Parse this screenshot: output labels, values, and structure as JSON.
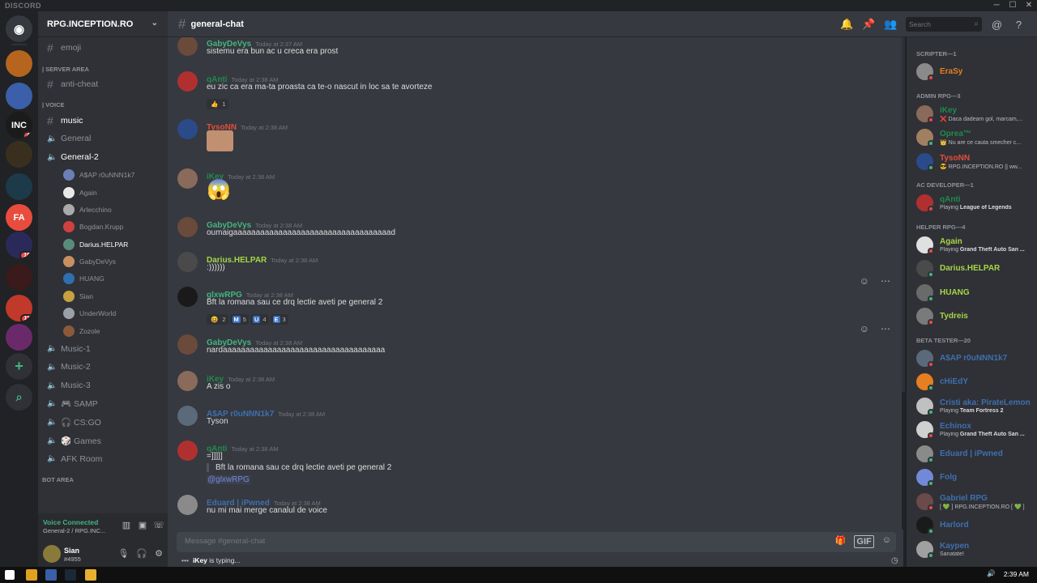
{
  "app": {
    "title": "DISCORD",
    "window_controls": [
      "─",
      "☐",
      "✕"
    ]
  },
  "server": {
    "name": "RPG.INCEPTION.RO"
  },
  "guilds": [
    {
      "name": "home",
      "color": "#36393f",
      "icon": "discord-icon"
    },
    {
      "name": "g1",
      "color": "#b5651d"
    },
    {
      "name": "g2",
      "color": "#3b5fa8"
    },
    {
      "name": "g3",
      "color": "#1b1b1b",
      "label": "INC",
      "badge": "4"
    },
    {
      "name": "g4",
      "color": "#3a2f1e"
    },
    {
      "name": "g5",
      "color": "#1c3a4a"
    },
    {
      "name": "g6",
      "color": "#e84c3d",
      "label": "FA"
    },
    {
      "name": "g7",
      "color": "#2a2a5a",
      "badge": "10"
    },
    {
      "name": "g8",
      "color": "#3a1a1a"
    },
    {
      "name": "g9",
      "color": "#c0392b",
      "badge": "11"
    },
    {
      "name": "g10",
      "color": "#6a2a6a"
    }
  ],
  "channels": {
    "top": [
      {
        "name": "emoji"
      }
    ],
    "server_area": {
      "label": "| SERVER AREA",
      "items": [
        {
          "name": "anti-cheat"
        }
      ]
    },
    "voice": {
      "label": "| VOICE",
      "items": [
        {
          "name": "music",
          "type": "text",
          "active": true
        },
        {
          "name": "General",
          "type": "voice"
        },
        {
          "name": "General-2",
          "type": "voice",
          "active": true,
          "users": [
            {
              "name": "A$AP r0uNNN1k7"
            },
            {
              "name": "Again"
            },
            {
              "name": "Arlecchino"
            },
            {
              "name": "Bogdan.Krupp"
            },
            {
              "name": "Darius.HELPAR",
              "bright": true
            },
            {
              "name": "GabyDeVys"
            },
            {
              "name": "HUANG"
            },
            {
              "name": "Sian"
            },
            {
              "name": "UnderWorld"
            },
            {
              "name": "Zozole"
            }
          ]
        },
        {
          "name": "Music-1",
          "type": "voice"
        },
        {
          "name": "Music-2",
          "type": "voice"
        },
        {
          "name": "Music-3",
          "type": "voice"
        },
        {
          "name": "🎮 SAMP",
          "type": "voice"
        },
        {
          "name": "🎧 CS:GO",
          "type": "voice"
        },
        {
          "name": "🎲 Games",
          "type": "voice"
        },
        {
          "name": "AFK Room",
          "type": "voice"
        }
      ]
    },
    "bot_area": {
      "label": "BOT AREA"
    }
  },
  "voice_panel": {
    "status": "Voice Connected",
    "channel": "General-2 / RPG.INC..."
  },
  "user_panel": {
    "username": "Sian",
    "tag": "#4955"
  },
  "chat": {
    "channel": "general-chat",
    "search_placeholder": "Search",
    "composer_placeholder": "Message #general-chat",
    "typing_user": "iKey",
    "typing_suffix": " is typing..."
  },
  "messages": [
    {
      "user": "GabyDeVys",
      "color": "#43b581",
      "time": "Today at 2:37 AM",
      "text": "sistemu era bun ac u creca era prost",
      "av": "#6a4a3a"
    },
    {
      "user": "qAnti",
      "color": "#1f8b4c",
      "time": "Today at 2:38 AM",
      "text": "eu zic ca era ma-ta proasta ca te-o nascut in loc sa te avorteze",
      "reactions": [
        {
          "e": "👍",
          "n": "1"
        }
      ],
      "av": "#b03030"
    },
    {
      "user": "TysoNN",
      "color": "#e74c3c",
      "time": "Today at 2:38 AM",
      "text": "",
      "image": true,
      "av": "#2a4a8a"
    },
    {
      "user": "iKey",
      "color": "#1f8b4c",
      "time": "Today at 2:38 AM",
      "text": "😱",
      "big_emoji": true,
      "av": "#8a6a5a"
    },
    {
      "user": "GabyDeVys",
      "color": "#43b581",
      "time": "Today at 2:38 AM",
      "text": "oumaigaaaaaaaaaaaaaaaaaaaaaaaaaaaaaaaaaaad",
      "av": "#6a4a3a"
    },
    {
      "user": "Darius.HELPAR",
      "color": "#a5d648",
      "time": "Today at 2:38 AM",
      "text": ":))))))",
      "av": "#4a4a4a"
    },
    {
      "user": "glxwRPG",
      "color": "#43b581",
      "time": "Today at 2:38 AM",
      "text": "Bft la romana sau ce drq lectie aveti pe general 2",
      "reactions": [
        {
          "e": "😆",
          "n": "2"
        },
        {
          "e": "M",
          "n": "5"
        },
        {
          "e": "U",
          "n": "4"
        },
        {
          "e": "E",
          "n": "3"
        }
      ],
      "av": "#1a1a1a"
    },
    {
      "user": "GabyDeVys",
      "color": "#43b581",
      "time": "Today at 2:38 AM",
      "text": "nardaaaaaaaaaaaaaaaaaaaaaaaaaaaaaaaaaaaa",
      "av": "#6a4a3a"
    },
    {
      "user": "iKey",
      "color": "#1f8b4c",
      "time": "Today at 2:38 AM",
      "text": "A zis o",
      "av": "#8a6a5a"
    },
    {
      "user": "A$AP r0uNNN1k7",
      "color": "#3f6fb0",
      "time": "Today at 2:38 AM",
      "text": "Tyson",
      "av": "#5a6a7a"
    },
    {
      "user": "qAnti",
      "color": "#1f8b4c",
      "time": "Today at 2:38 AM",
      "text": "=]]]]]",
      "quote": "Bft la romana sau ce drq lectie aveti pe general 2",
      "mention": "@glxwRPG",
      "av": "#b03030"
    },
    {
      "user": "Eduard | iPwned",
      "color": "#3f6fb0",
      "time": "Today at 2:38 AM",
      "text": "nu mi mai merge canalul de voice",
      "av": "#8a8a8a"
    }
  ],
  "members": {
    "categories": [
      {
        "label": "SCRIPTER—1",
        "items": [
          {
            "name": "EraSy",
            "color": "#e67e22",
            "av": "#8a8a8a"
          }
        ]
      },
      {
        "label": "ADMIN RPG—3",
        "items": [
          {
            "name": "iKey",
            "color": "#1f8b4c",
            "status": "❌ Daca dadeam gol, marcam,...",
            "av": "#8a6a5a"
          },
          {
            "name": "Oprea™",
            "color": "#1f8b4c",
            "status": "👑 Nu are ce cauta smecher c...",
            "av": "#a08060"
          },
          {
            "name": "TysoNN",
            "color": "#e74c3c",
            "status": "😎 RPG.INCEPTION.RO || ww...",
            "av": "#2a4a8a"
          }
        ]
      },
      {
        "label": "AC DEVELOPER—1",
        "items": [
          {
            "name": "qAnti",
            "color": "#1f8b4c",
            "status_pre": "Playing ",
            "status_game": "League of Legends",
            "av": "#b03030"
          }
        ]
      },
      {
        "label": "HELPER RPG—4",
        "items": [
          {
            "name": "Again",
            "color": "#a5d648",
            "status_pre": "Playing ",
            "status_game": "Grand Theft Auto San ...",
            "av": "#e0e0e0"
          },
          {
            "name": "Darius.HELPAR",
            "color": "#a5d648",
            "av": "#4a4a4a"
          },
          {
            "name": "HUANG",
            "color": "#a5d648",
            "av": "#6a6a6a"
          },
          {
            "name": "Tydreis",
            "color": "#a5d648",
            "av": "#7a7a7a"
          }
        ]
      },
      {
        "label": "BETA TESTER—20",
        "items": [
          {
            "name": "A$AP r0uNNN1k7",
            "color": "#3f6fb0",
            "av": "#5a6a7a"
          },
          {
            "name": "cHiEdY",
            "color": "#3f6fb0",
            "av": "#e67e22"
          },
          {
            "name": "Cristi aka: PirateLemon",
            "color": "#3f6fb0",
            "status_pre": "Playing ",
            "status_game": "Team Fortress 2",
            "av": "#c0c0c0"
          },
          {
            "name": "Echinox",
            "color": "#3f6fb0",
            "status_pre": "Playing ",
            "status_game": "Grand Theft Auto San ...",
            "av": "#d0d0d0"
          },
          {
            "name": "Eduard | iPwned",
            "color": "#3f6fb0",
            "av": "#8a8a8a"
          },
          {
            "name": "Folg",
            "color": "#3f6fb0",
            "av": "#7289da"
          },
          {
            "name": "Gabriel RPG",
            "color": "#3f6fb0",
            "status": "[ 💚 ] RPG.INCEPTION.RO [ 💚 ]",
            "av": "#6a4a4a"
          },
          {
            "name": "Harlord",
            "color": "#3f6fb0",
            "av": "#1a1a1a"
          },
          {
            "name": "Kaypen",
            "color": "#3f6fb0",
            "status": "Sanatate!",
            "av": "#a0a0a0"
          }
        ]
      }
    ]
  },
  "taskbar": {
    "time": "2:39 AM"
  }
}
